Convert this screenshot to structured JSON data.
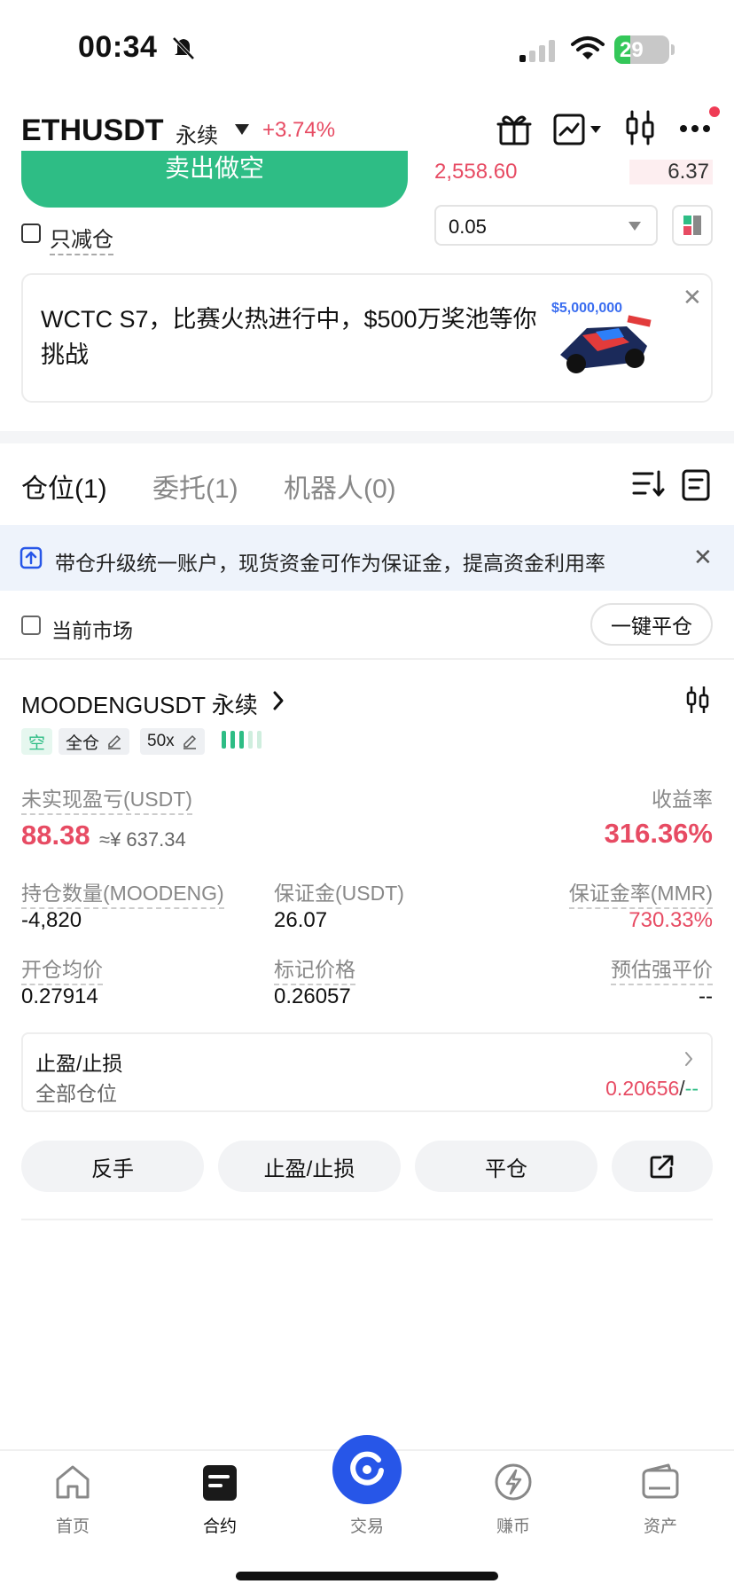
{
  "status": {
    "time": "00:34",
    "battery": "29"
  },
  "header": {
    "symbol": "ETHUSDT",
    "type": "永续",
    "change": "+3.74%"
  },
  "order_form": {
    "sell_label": "卖出做空",
    "reduce_only_label": "只减仓",
    "orderbook_price": "2,558.60",
    "orderbook_qty": "6.37",
    "qty_step": "0.05"
  },
  "banner": {
    "text": "WCTC S7，比赛火热进行中，$500万奖池等你挑战",
    "prize": "$5,000,000"
  },
  "tabs": [
    {
      "label": "仓位(1)"
    },
    {
      "label": "委托(1)"
    },
    {
      "label": "机器人(0)"
    }
  ],
  "notice": {
    "text": "带仓升级统一账户，现货资金可作为保证金，提高资金利用率"
  },
  "filter": {
    "current_market_label": "当前市场",
    "close_all_label": "一键平仓"
  },
  "position": {
    "title": "MOODENGUSDT 永续",
    "side_tag": "空",
    "margin_mode": "全仓",
    "leverage": "50x",
    "pnl_label": "未实现盈亏(USDT)",
    "pnl_value": "88.38",
    "pnl_cny": "≈¥ 637.34",
    "roe_label": "收益率",
    "roe_value": "316.36%",
    "qty_label": "持仓数量(MOODENG)",
    "qty_value": "-4,820",
    "margin_label": "保证金(USDT)",
    "margin_value": "26.07",
    "mmr_label": "保证金率(MMR)",
    "mmr_value": "730.33%",
    "entry_label": "开仓均价",
    "entry_value": "0.27914",
    "mark_label": "标记价格",
    "mark_value": "0.26057",
    "liq_label": "预估强平价",
    "liq_value": "--",
    "tpsl_title": "止盈/止损",
    "tpsl_scope": "全部仓位",
    "tp_value": "0.20656",
    "sl_value": "--",
    "actions": [
      "反手",
      "止盈/止损",
      "平仓"
    ]
  },
  "nav": [
    {
      "label": "首页"
    },
    {
      "label": "合约"
    },
    {
      "label": "交易"
    },
    {
      "label": "赚币"
    },
    {
      "label": "资产"
    }
  ],
  "colors": {
    "up": "#2ebd85",
    "down": "#e74b63",
    "accent": "#2756e8"
  }
}
